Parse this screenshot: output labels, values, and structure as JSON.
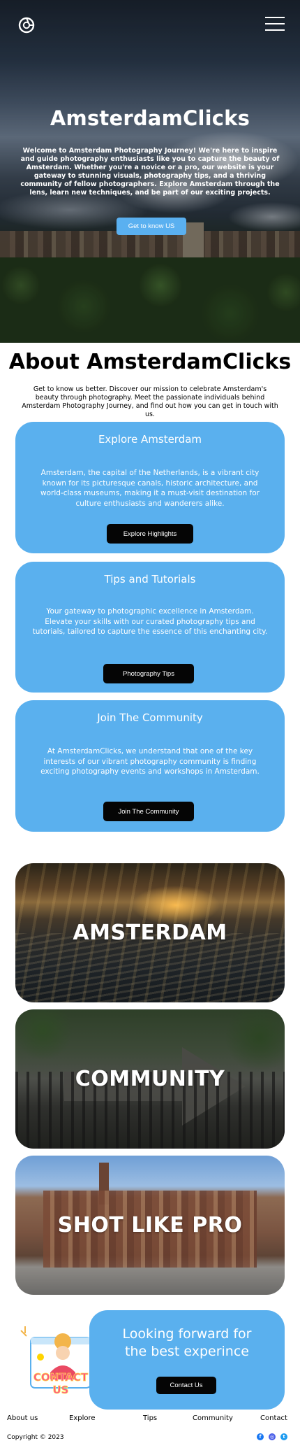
{
  "header": {
    "logo_icon": "camera-shutter-icon",
    "menu_icon": "hamburger-menu-icon"
  },
  "hero": {
    "title": "AmsterdamClicks",
    "text": "Welcome to Amsterdam Photography Journey! We're here to inspire and guide photography enthusiasts like you to capture the beauty of Amsterdam. Whether you're a novice or a pro, our website is your gateway to stunning visuals, photography tips, and a thriving community of fellow photographers. Explore Amsterdam through the lens, learn new techniques, and be part of our exciting projects.",
    "button": "Get to know US"
  },
  "about": {
    "title": "About AmsterdamClicks",
    "text": "Get to know us better. Discover our mission to celebrate Amsterdam's beauty through photography. Meet the passionate individuals behind Amsterdam Photography Journey, and find out how you can get in touch with us."
  },
  "cards": [
    {
      "title": "Explore Amsterdam",
      "text": "Amsterdam, the capital of the Netherlands, is a vibrant city known for its picturesque canals, historic architecture, and world-class museums, making it a must-visit destination for culture enthusiasts and wanderers alike.",
      "button": "Explore Highlights"
    },
    {
      "title": "Tips and Tutorials",
      "text": "Your gateway to photographic excellence in Amsterdam. Elevate your skills with our curated photography tips and tutorials, tailored to capture the essence of this enchanting city.",
      "button": "Photography Tips"
    },
    {
      "title": "Join The Community",
      "text": "At AmsterdamClicks, we understand that one of the key interests of our vibrant photography community is finding exciting photography events and workshops in Amsterdam.",
      "button": "Join The Community"
    }
  ],
  "tiles": [
    {
      "label": "AMSTERDAM"
    },
    {
      "label": "COMMUNITY"
    },
    {
      "label": "SHOT LIKE PRO"
    }
  ],
  "contact": {
    "title_line1": "Looking forward for",
    "title_line2": "the best experince",
    "button": "Contact Us",
    "illustration_text_1": "CONTACT",
    "illustration_text_2": "US"
  },
  "footer": {
    "nav": [
      "About us",
      "Explore",
      "Tips",
      "Community",
      "Contact"
    ],
    "copyright": "Copyright © 2023",
    "socials": [
      "facebook-icon",
      "instagram-icon",
      "twitter-icon"
    ]
  },
  "colors": {
    "accent_blue": "#5ab0ee",
    "button_dark": "#050505"
  }
}
